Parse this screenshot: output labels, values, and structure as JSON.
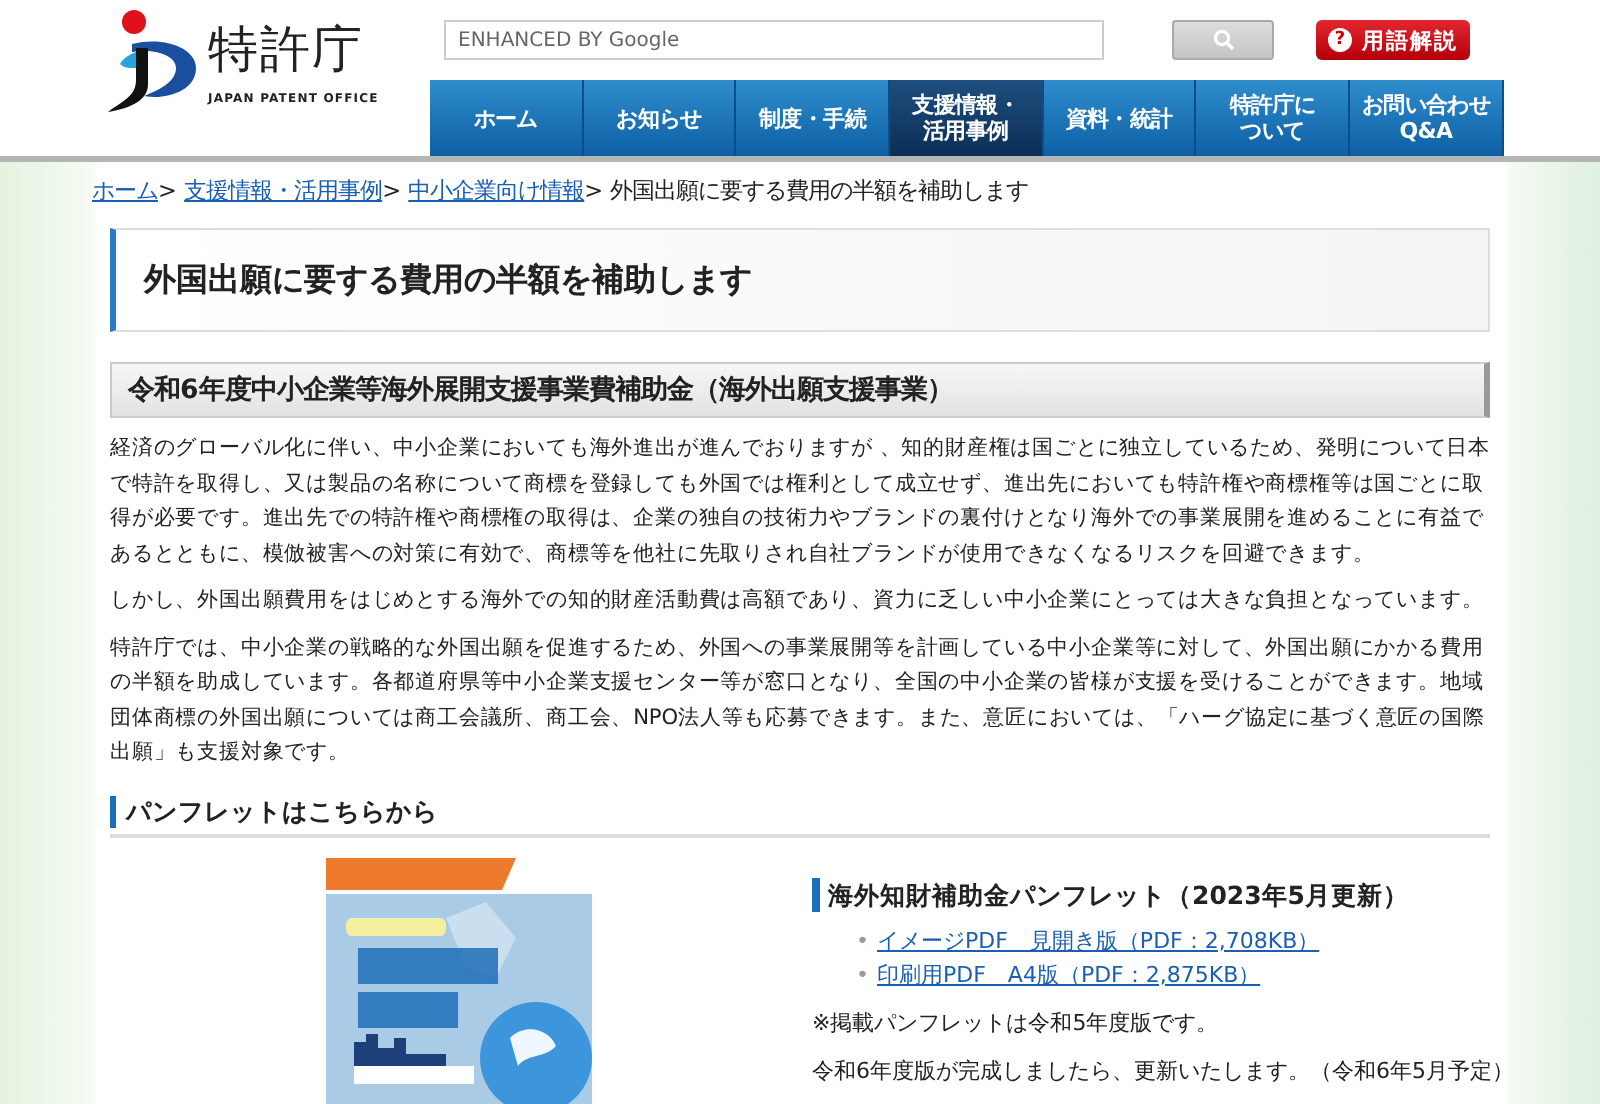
{
  "header": {
    "logo": {
      "name": "特許庁",
      "subtitle": "JAPAN PATENT OFFICE"
    },
    "search": {
      "placeholder": "ENHANCED BY Google"
    },
    "glossary_button": {
      "icon": "?",
      "label": "用語解説"
    }
  },
  "nav": [
    {
      "label": [
        "ホーム"
      ],
      "selected": false
    },
    {
      "label": [
        "お知らせ"
      ],
      "selected": false
    },
    {
      "label": [
        "制度・手続"
      ],
      "selected": false
    },
    {
      "label": [
        "支援情報・",
        "活用事例"
      ],
      "selected": true
    },
    {
      "label": [
        "資料・統計"
      ],
      "selected": false
    },
    {
      "label": [
        "特許庁に",
        "ついて"
      ],
      "selected": false
    },
    {
      "label": [
        "お問い合わせ",
        "Q&A"
      ],
      "selected": false
    }
  ],
  "breadcrumb": {
    "separator": ">",
    "links": [
      "ホーム",
      "支援情報・活用事例",
      "中小企業向け情報"
    ],
    "current": "外国出願に要する費用の半額を補助します"
  },
  "page_title": "外国出願に要する費用の半額を補助します",
  "section_title": "令和6年度中小企業等海外展開支援事業費補助金（海外出願支援事業）",
  "paragraphs": [
    "経済のグローバル化に伴い、中小企業においても海外進出が進んでおりますが 、知的財産権は国ごとに独立しているため、発明について日本で特許を取得し、又は製品の名称について商標を登録しても外国では権利として成立せず、進出先においても特許権や商標権等は国ごとに取得が必要です。進出先での特許権や商標権の取得は、企業の独自の技術力やブランドの裏付けとなり海外での事業展開を進めることに有益であるとともに、模倣被害への対策に有効で、商標等を他社に先取りされ自社ブランドが使用できなくなるリスクを回避できます。",
    "しかし、外国出願費用をはじめとする海外での知的財産活動費は高額であり、資力に乏しい中小企業にとっては大きな負担となっています。",
    "特許庁では、中小企業の戦略的な外国出願を促進するため、外国への事業展開等を計画している中小企業等に対して、外国出願にかかる費用の半額を助成しています。各都道府県等中小企業支援センター等が窓口となり、全国の中小企業の皆様が支援を受けることができます。地域団体商標の外国出願については商工会議所、商工会、NPO法人等も応募できます。また、意匠においては、「ハーグ協定に基づく意匠の国際出願」も支援対象です。"
  ],
  "pamphlet_section": {
    "title": "パンフレットはこちらから",
    "cover": {
      "kind": "picture"
    },
    "heading": "海外知財補助金パンフレット（2023年5月更新）",
    "marker": "•",
    "links": [
      "イメージPDF　見開き版（PDF：2,708KB）",
      "印刷用PDF　A4版（PDF：2,875KB）"
    ],
    "notes": [
      "※掲載パンフレットは令和5年度版です。",
      "令和6年度版が完成しましたら、更新いたします。（令和6年5月予定）"
    ]
  }
}
